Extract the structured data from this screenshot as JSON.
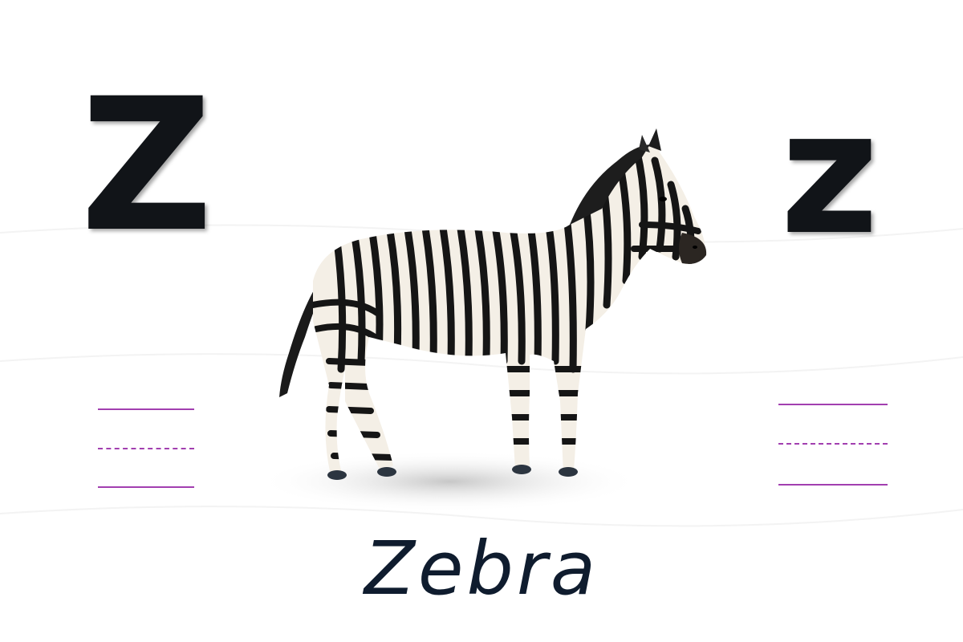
{
  "card": {
    "uppercase_letter": "Z",
    "lowercase_letter": "z",
    "word": "Zebra"
  },
  "image": {
    "subject_icon": "zebra-icon"
  },
  "colors": {
    "letter": "#111418",
    "guide_lines": "#a23fb0",
    "word": "#0f1c2e"
  }
}
